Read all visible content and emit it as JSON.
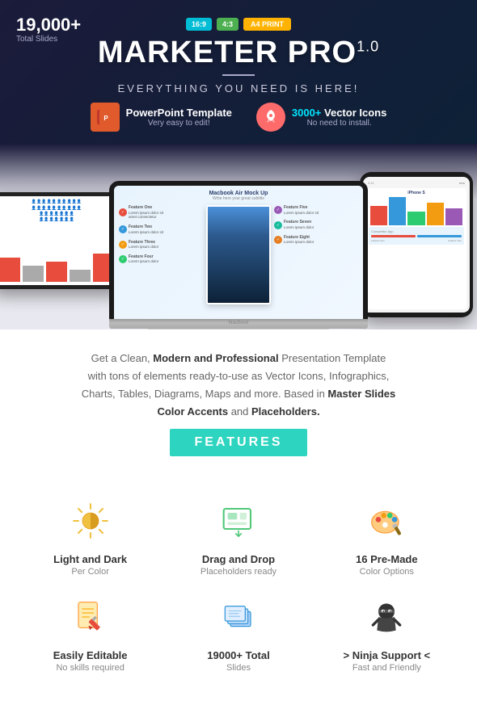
{
  "header": {
    "slides_count": "19,000+",
    "slides_label": "Total Slides",
    "badge_169": "16:9",
    "badge_43": "4:3",
    "badge_a4": "A4 PRINT",
    "title": "MARKETER PRO",
    "version": "1.0",
    "subtitle": "EVERYTHING YOU NEED IS HERE!"
  },
  "powerpoint": {
    "label": "PowerPoint Template",
    "sub": "Very easy to edit!"
  },
  "icons_feature": {
    "highlight": "3000+",
    "label": " Vector Icons",
    "sub": "No need to install."
  },
  "mockup": {
    "laptop_title": "Macbook Air Mock Up",
    "laptop_sub": "Write here your great subtitle",
    "features": [
      {
        "title": "Feature One",
        "color": "#e74c3c"
      },
      {
        "title": "Feature Two",
        "color": "#3498db"
      },
      {
        "title": "Feature Three",
        "color": "#f39c12"
      },
      {
        "title": "Feature Four",
        "color": "#2ecc71"
      },
      {
        "title": "Feature Five",
        "color": "#9b59b6"
      },
      {
        "title": "Feature Seven",
        "color": "#1abc9c"
      },
      {
        "title": "Feature Eight",
        "color": "#e67e22"
      }
    ]
  },
  "description": {
    "line1": "Get a Clean, ",
    "bold1": "Modern and Professional",
    "line2": " Presentation Template",
    "line3": "with tons of elements ready-to-use as Vector Icons, Infographics,",
    "line4": "Charts, Tables, Diagrams, Maps and more. Based in ",
    "bold2": "Master Slides",
    "line5": "Color Accents",
    "bold3": " and ",
    "bold4": "Placeholders."
  },
  "features_banner": "FEATURES",
  "feature_cards": [
    {
      "id": "light-dark",
      "title": "Light and Dark",
      "subtitle": "Per Color",
      "icon": "sun"
    },
    {
      "id": "drag-drop",
      "title": "Drag and Drop",
      "subtitle": "Placeholders ready",
      "icon": "drag"
    },
    {
      "id": "color-options",
      "title": "16 Pre-Made",
      "subtitle": "Color Options",
      "icon": "palette"
    }
  ],
  "feature_cards_row2": [
    {
      "id": "editable",
      "title": "Easily Editable",
      "subtitle": "No skills required",
      "icon": "edit"
    },
    {
      "id": "total-slides",
      "title": "19000+ Total",
      "subtitle": "Slides",
      "icon": "layers"
    },
    {
      "id": "support",
      "title": "> Ninja Support <",
      "subtitle": "Fast and Friendly",
      "icon": "ninja"
    }
  ]
}
